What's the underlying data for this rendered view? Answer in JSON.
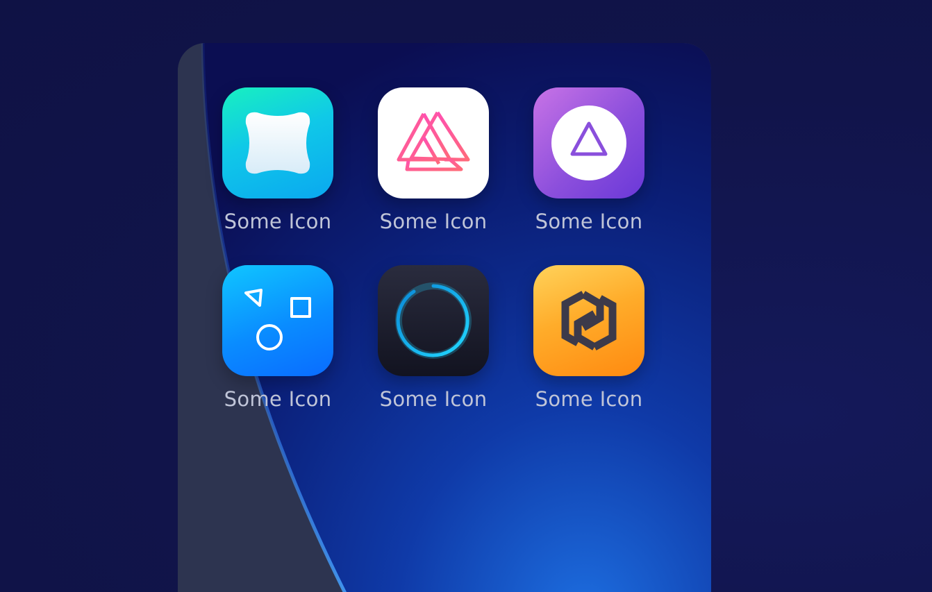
{
  "home_screen": {
    "apps": [
      {
        "label": "Some Icon",
        "icon": "sparkle-cushion-icon",
        "color": "#10c8e8"
      },
      {
        "label": "Some Icon",
        "icon": "interlocked-triangles-icon",
        "color": "#ff4fa8"
      },
      {
        "label": "Some Icon",
        "icon": "triangle-in-circle-icon",
        "color": "#8c4fdc"
      },
      {
        "label": "Some Icon",
        "icon": "shapes-icon",
        "color": "#0a8cff"
      },
      {
        "label": "Some Icon",
        "icon": "loading-ring-icon",
        "color": "#20d4ff"
      },
      {
        "label": "Some Icon",
        "icon": "hexagon-link-icon",
        "color": "#ffac2a"
      }
    ]
  }
}
